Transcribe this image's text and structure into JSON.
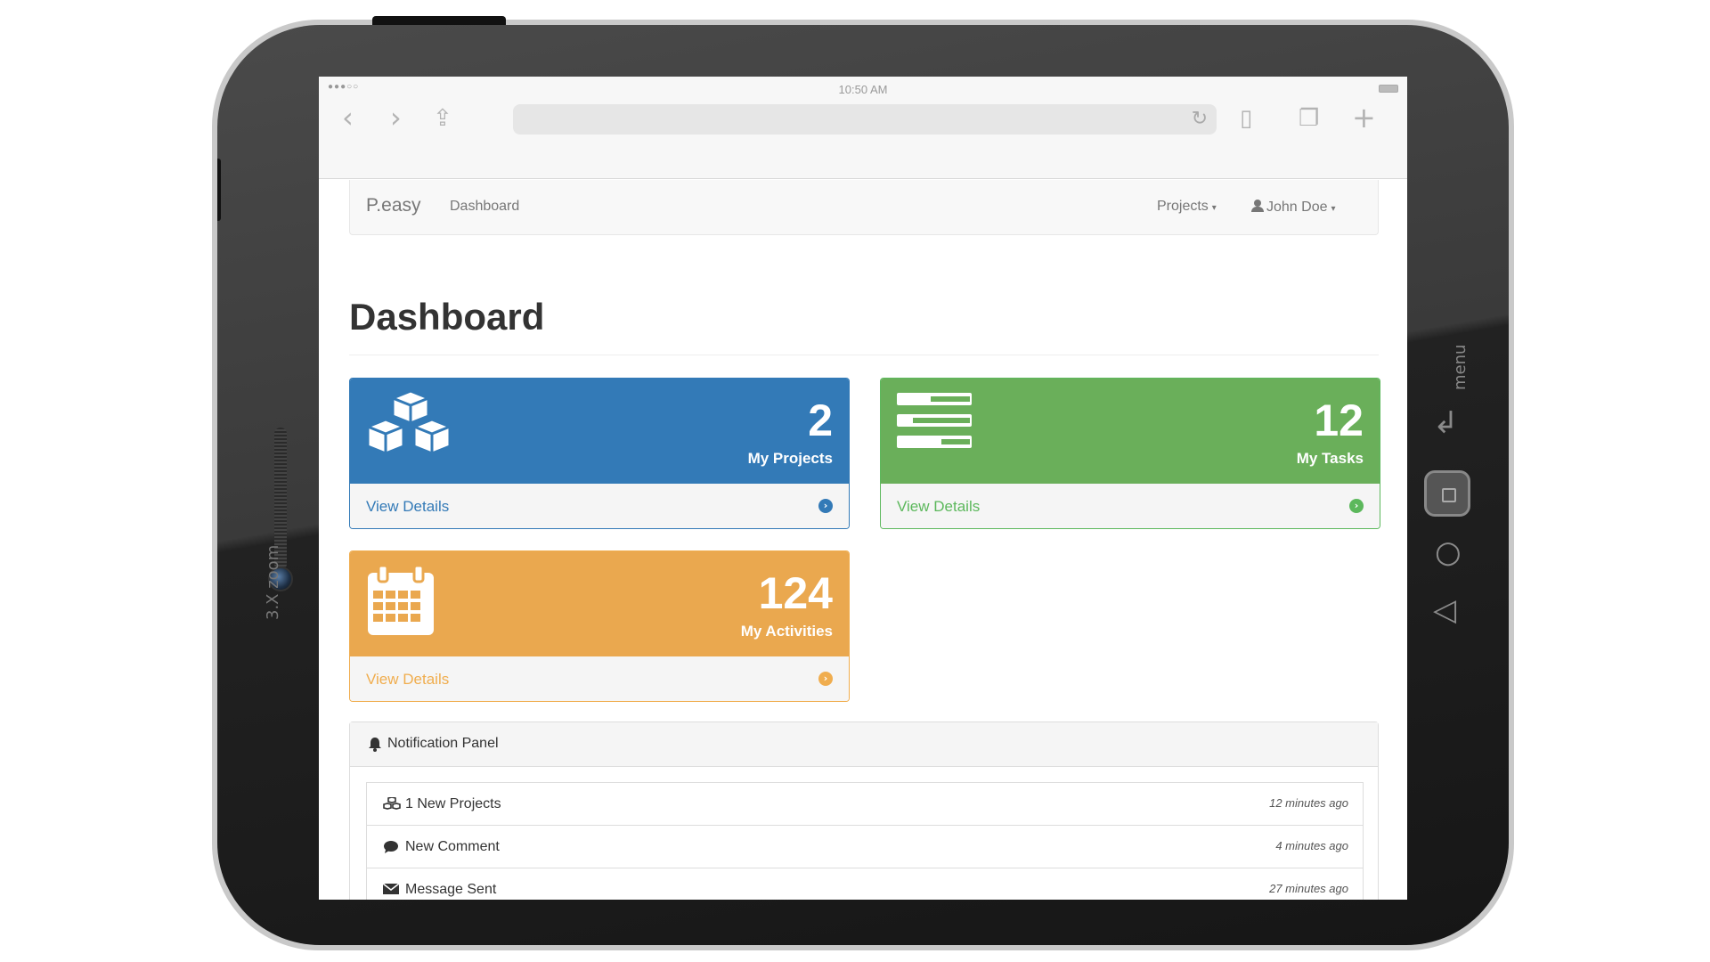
{
  "status_bar": {
    "signal": "●●●○○",
    "time": "10:50 AM"
  },
  "device": {
    "zoom_label": "3.X zoom",
    "menu_label": "menu"
  },
  "navbar": {
    "brand": "P.easy",
    "dashboard_link": "Dashboard",
    "projects_menu": "Projects",
    "user_menu": "John Doe"
  },
  "page": {
    "title": "Dashboard"
  },
  "cards": [
    {
      "count": "2",
      "label": "My Projects",
      "link": "View Details",
      "color": "#337ab7",
      "icon": "cubes-icon"
    },
    {
      "count": "12",
      "label": "My Tasks",
      "link": "View Details",
      "color": "#5cb85c",
      "icon": "tasks-icon"
    },
    {
      "count": "124",
      "label": "My Activities",
      "link": "View Details",
      "color": "#f0ad4e",
      "icon": "calendar-icon"
    }
  ],
  "notifications": {
    "title": "Notification Panel",
    "items": [
      {
        "text": "1 New Projects",
        "time": "12 minutes ago",
        "icon": "cubes-icon"
      },
      {
        "text": "New Comment",
        "time": "4 minutes ago",
        "icon": "comment-icon"
      },
      {
        "text": "Message Sent",
        "time": "27 minutes ago",
        "icon": "envelope-icon"
      }
    ]
  }
}
